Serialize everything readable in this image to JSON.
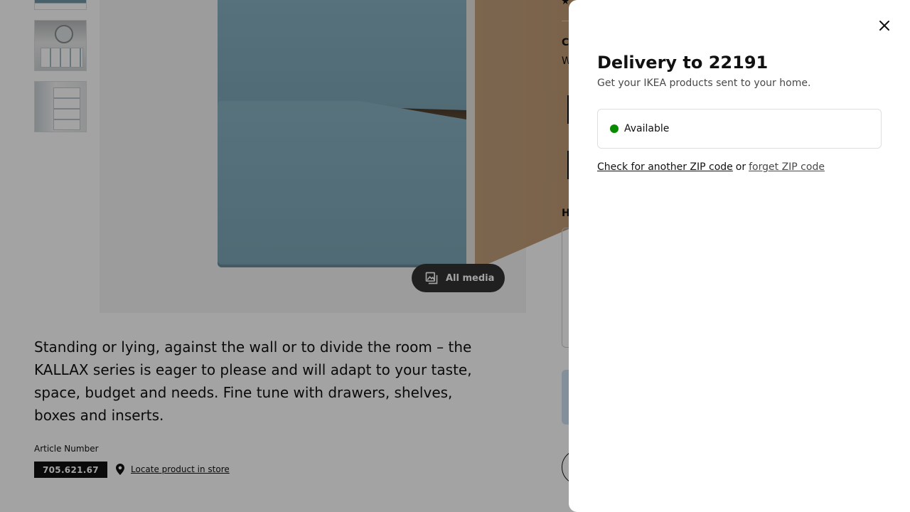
{
  "product": {
    "description": "Standing or lying, against the wall or to divide the room – the KALLAX series is eager to please and will adapt to your taste, space, budget and needs. Fine tune with drawers, shelves, boxes and inserts.",
    "all_media_label": "All media",
    "article_label": "Article Number",
    "article_number": "705.621.67",
    "locate_label": "Locate product in store"
  },
  "right_column": {
    "c_fragment": "C",
    "w_fragment": "W",
    "h_fragment": "H",
    "star": "★"
  },
  "delivery_panel": {
    "title": "Delivery to 22191",
    "subtitle": "Get your IKEA products sent to your home.",
    "status": "Available",
    "status_color": "#0a8a00",
    "check_link": "Check for another ZIP code",
    "or_text": "or",
    "forget_link": "forget ZIP code",
    "close_icon": "close-icon"
  }
}
